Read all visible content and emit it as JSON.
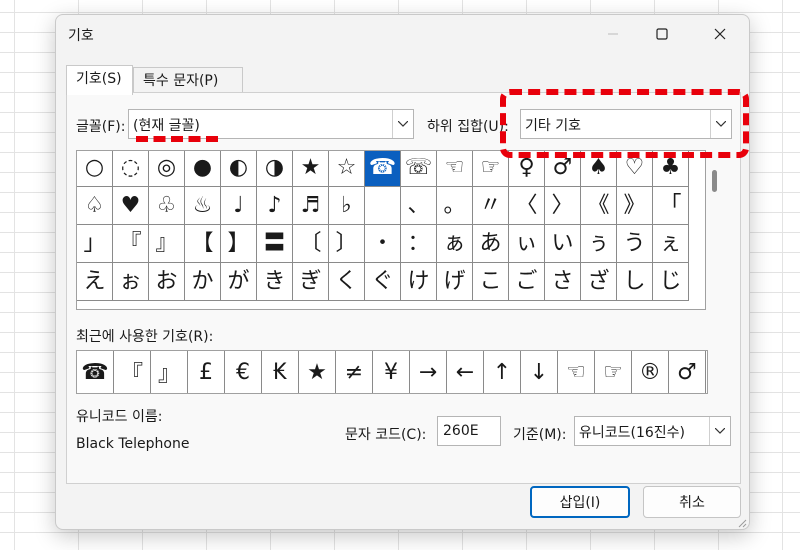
{
  "dialog": {
    "title": "기호",
    "tabs": [
      "기호(S)",
      "특수 문자(P)"
    ],
    "font_label": "글꼴(F):",
    "font_value": "(현재 글꼴)",
    "subset_label": "하위 집합(U):",
    "subset_value": "기타 기호",
    "symbol_rows": [
      [
        "○",
        "◌",
        "◎",
        "●",
        "◐",
        "◑",
        "★",
        "☆",
        "☎",
        "☏",
        "☜",
        "☞",
        "♀",
        "♂",
        "♠",
        "♡",
        "♣"
      ],
      [
        "♤",
        "♥",
        "♧",
        "♨",
        "♩",
        "♪",
        "♬",
        "♭",
        "",
        "、",
        "。",
        "〃",
        "〈",
        "〉",
        "《",
        "》",
        "「"
      ],
      [
        "」",
        "『",
        "』",
        "【",
        "】",
        "〓",
        "〔",
        "〕",
        "・",
        "：",
        "ぁ",
        "あ",
        "ぃ",
        "い",
        "ぅ",
        "う",
        "ぇ"
      ],
      [
        "え",
        "ぉ",
        "お",
        "か",
        "が",
        "き",
        "ぎ",
        "く",
        "ぐ",
        "け",
        "げ",
        "こ",
        "ご",
        "さ",
        "ざ",
        "し",
        "じ"
      ]
    ],
    "selected_symbol": "☎",
    "recent_label": "최근에 사용한 기호(R):",
    "recent_symbols": [
      "☎",
      "『",
      "』",
      "£",
      "€",
      "₭",
      "★",
      "≠",
      "¥",
      "→",
      "←",
      "↑",
      "↓",
      "☜",
      "☞",
      "®",
      "♂"
    ],
    "unicode_name_label": "유니코드 이름:",
    "unicode_name": "Black Telephone",
    "char_code_label": "문자 코드(C):",
    "char_code": "260E",
    "basis_label": "기준(M):",
    "basis_value": "유니코드(16진수)",
    "insert_label": "삽입(I)",
    "cancel_label": "취소",
    "colors": {
      "selection": "#0b5fbf",
      "annotation": "#e8000b",
      "primary_border": "#0067c0"
    }
  }
}
